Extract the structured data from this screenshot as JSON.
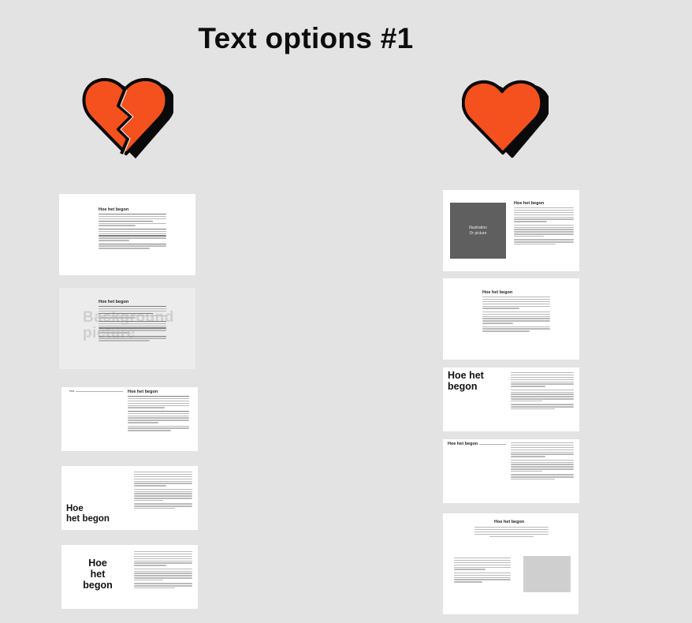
{
  "page": {
    "title": "Text options #1"
  },
  "icons": {
    "negative": "broken-heart-icon",
    "positive": "heart-icon",
    "heart_color": "#f4511e",
    "outline_color": "#0a0a0a"
  },
  "left_column": {
    "card1": {
      "heading": "Hoe het begon"
    },
    "card2": {
      "heading": "Hoe het begon",
      "background_label": "Background\npicture"
    },
    "card3": {
      "heading": "Hoe het begon",
      "side_label": "Hoe"
    },
    "card4": {
      "heading": "Hoe\nhet begon"
    },
    "card5": {
      "heading": "Hoe\nhet\nbegon"
    }
  },
  "right_column": {
    "card1": {
      "heading": "Hoe het begon",
      "placeholder": "Illustration\nOr picture"
    },
    "card2": {
      "heading": "Hoe het begon"
    },
    "card3": {
      "heading": "Hoe het\nbegon"
    },
    "card4": {
      "heading": "Hoe het begon"
    },
    "card5": {
      "heading": "Hoe het begon"
    }
  }
}
